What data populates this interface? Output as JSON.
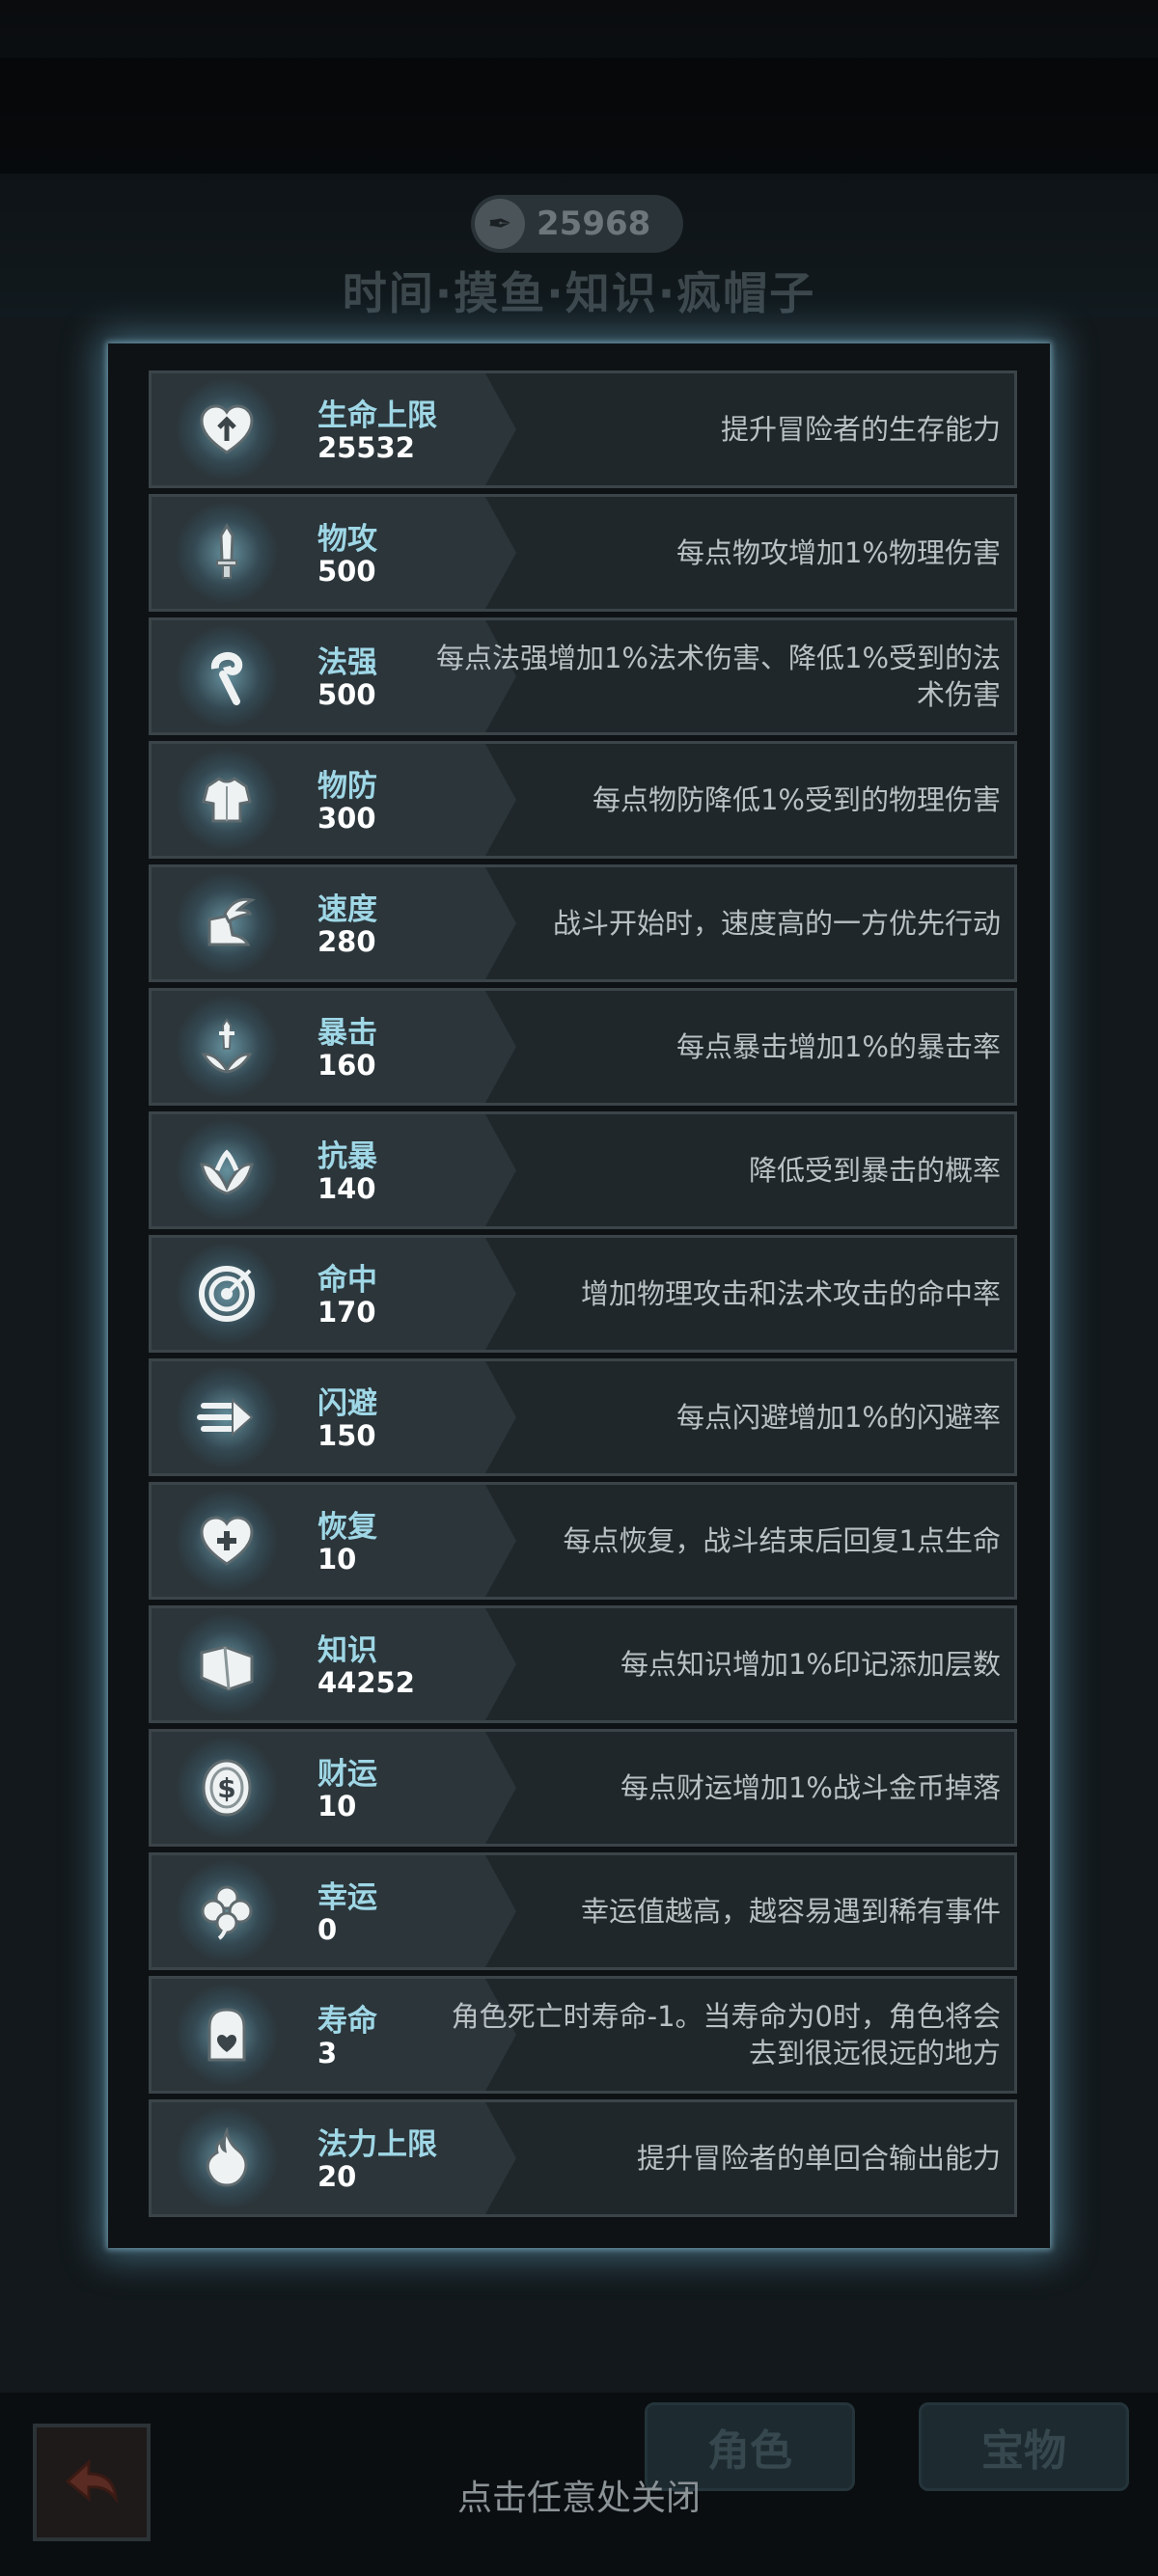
{
  "header": {
    "coin_icon": "quill-coin-icon",
    "coin_value": "25968",
    "subtitle": "时间·摸鱼·知识·疯帽子"
  },
  "stats": [
    {
      "icon": "heart-arrow-icon",
      "name": "生命上限",
      "value": "25532",
      "desc": "提升冒险者的生存能力"
    },
    {
      "icon": "dagger-icon",
      "name": "物攻",
      "value": "500",
      "desc": "每点物攻增加1%物理伤害"
    },
    {
      "icon": "staff-icon",
      "name": "法强",
      "value": "500",
      "desc": "每点法强增加1%法术伤害、降低1%受到的法术伤害"
    },
    {
      "icon": "armor-icon",
      "name": "物防",
      "value": "300",
      "desc": "每点物防降低1%受到的物理伤害"
    },
    {
      "icon": "winged-boot-icon",
      "name": "速度",
      "value": "280",
      "desc": "战斗开始时，速度高的一方优先行动"
    },
    {
      "icon": "sword-burst-icon",
      "name": "暴击",
      "value": "160",
      "desc": "每点暴击增加1%的暴击率"
    },
    {
      "icon": "shield-burst-icon",
      "name": "抗暴",
      "value": "140",
      "desc": "降低受到暴击的概率"
    },
    {
      "icon": "target-icon",
      "name": "命中",
      "value": "170",
      "desc": "增加物理攻击和法术攻击的命中率"
    },
    {
      "icon": "dash-arrow-icon",
      "name": "闪避",
      "value": "150",
      "desc": "每点闪避增加1%的闪避率"
    },
    {
      "icon": "heart-plus-icon",
      "name": "恢复",
      "value": "10",
      "desc": "每点恢复，战斗结束后回复1点生命"
    },
    {
      "icon": "book-icon",
      "name": "知识",
      "value": "44252",
      "desc": "每点知识增加1%印记添加层数"
    },
    {
      "icon": "coin-dollar-icon",
      "name": "财运",
      "value": "10",
      "desc": "每点财运增加1%战斗金币掉落"
    },
    {
      "icon": "clover-icon",
      "name": "幸运",
      "value": "0",
      "desc": "幸运值越高，越容易遇到稀有事件"
    },
    {
      "icon": "tombstone-icon",
      "name": "寿命",
      "value": "3",
      "desc": "角色死亡时寿命-1。当寿命为0时，角色将会去到很远很远的地方"
    },
    {
      "icon": "mana-drop-icon",
      "name": "法力上限",
      "value": "20",
      "desc": "提升冒险者的单回合输出能力"
    }
  ],
  "bottom": {
    "back_icon": "back-arrow-icon",
    "tab_role": "角色",
    "tab_treasure": "宝物",
    "close_hint": "点击任意处关闭"
  },
  "colors": {
    "stat_name": "#9fd7e6",
    "stat_value": "#ffffff",
    "desc_text": "#b9c1c4",
    "panel_glow": "#78bee1"
  }
}
